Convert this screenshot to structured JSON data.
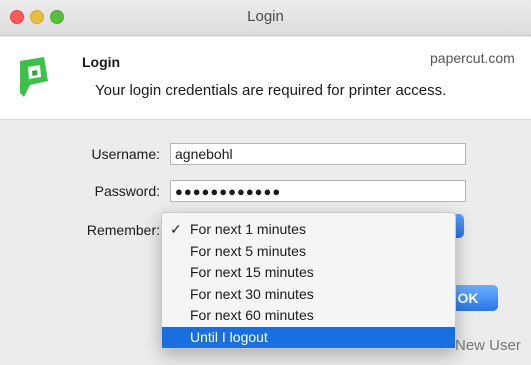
{
  "window": {
    "title": "Login"
  },
  "header": {
    "title": "Login",
    "description": "Your login credentials are required for printer access.",
    "site": "papercut.com"
  },
  "form": {
    "username_label": "Username:",
    "username_value": "agnebohl",
    "password_label": "Password:",
    "password_value": "●●●●●●●●●●●●",
    "remember_label": "Remember:"
  },
  "remember_options": {
    "selected": "Until I logout",
    "items": [
      {
        "label": "For next 1 minutes",
        "checked": true
      },
      {
        "label": "For next 5 minutes"
      },
      {
        "label": "For next 15 minutes"
      },
      {
        "label": "For next 30 minutes"
      },
      {
        "label": "For next 60 minutes"
      },
      {
        "label": "Until I logout",
        "highlighted": true
      }
    ]
  },
  "buttons": {
    "ok_label": "OK",
    "new_user_label": "New User"
  },
  "colors": {
    "accent": "#1a6fe0",
    "logo_green": "#3cc04a",
    "close": "#fc5b57",
    "minimize": "#e5bf3c",
    "zoom": "#57c038"
  }
}
